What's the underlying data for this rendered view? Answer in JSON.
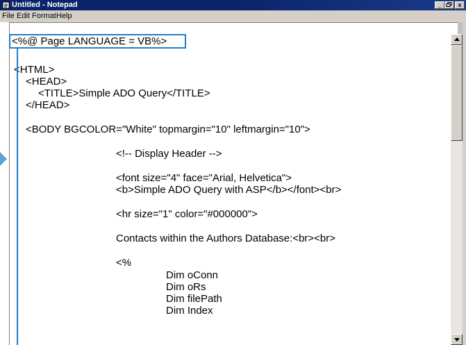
{
  "window": {
    "title": "Untitled - Notepad",
    "controls": {
      "minimize": "_",
      "maximize": "̵",
      "close": "x"
    }
  },
  "menu": {
    "items": [
      "File",
      "Edit",
      "Format",
      "Help"
    ]
  },
  "editor": {
    "lines": [
      "<%@ Page LANGUAGE = VB%>",
      "<HTML>",
      "<HEAD>",
      "<TITLE>Simple ADO Query</TITLE>",
      "</HEAD>",
      "<BODY BGCOLOR=\"White\" topmargin=\"10\" leftmargin=\"10\">",
      "<!-- Display Header -->",
      "<font size=\"4\" face=\"Arial, Helvetica\">",
      "<b>Simple ADO Query with ASP</b></font><br>",
      "<hr size=\"1\" color=\"#000000\">",
      "Contacts within the Authors Database:<br><br>",
      "<%",
      "Dim oConn",
      "Dim oRs",
      "Dim filePath",
      "Dim Index"
    ]
  },
  "colors": {
    "titlebar": "#0a246a",
    "highlight": "#1e7fc4",
    "pointer": "#5aa2d8"
  }
}
